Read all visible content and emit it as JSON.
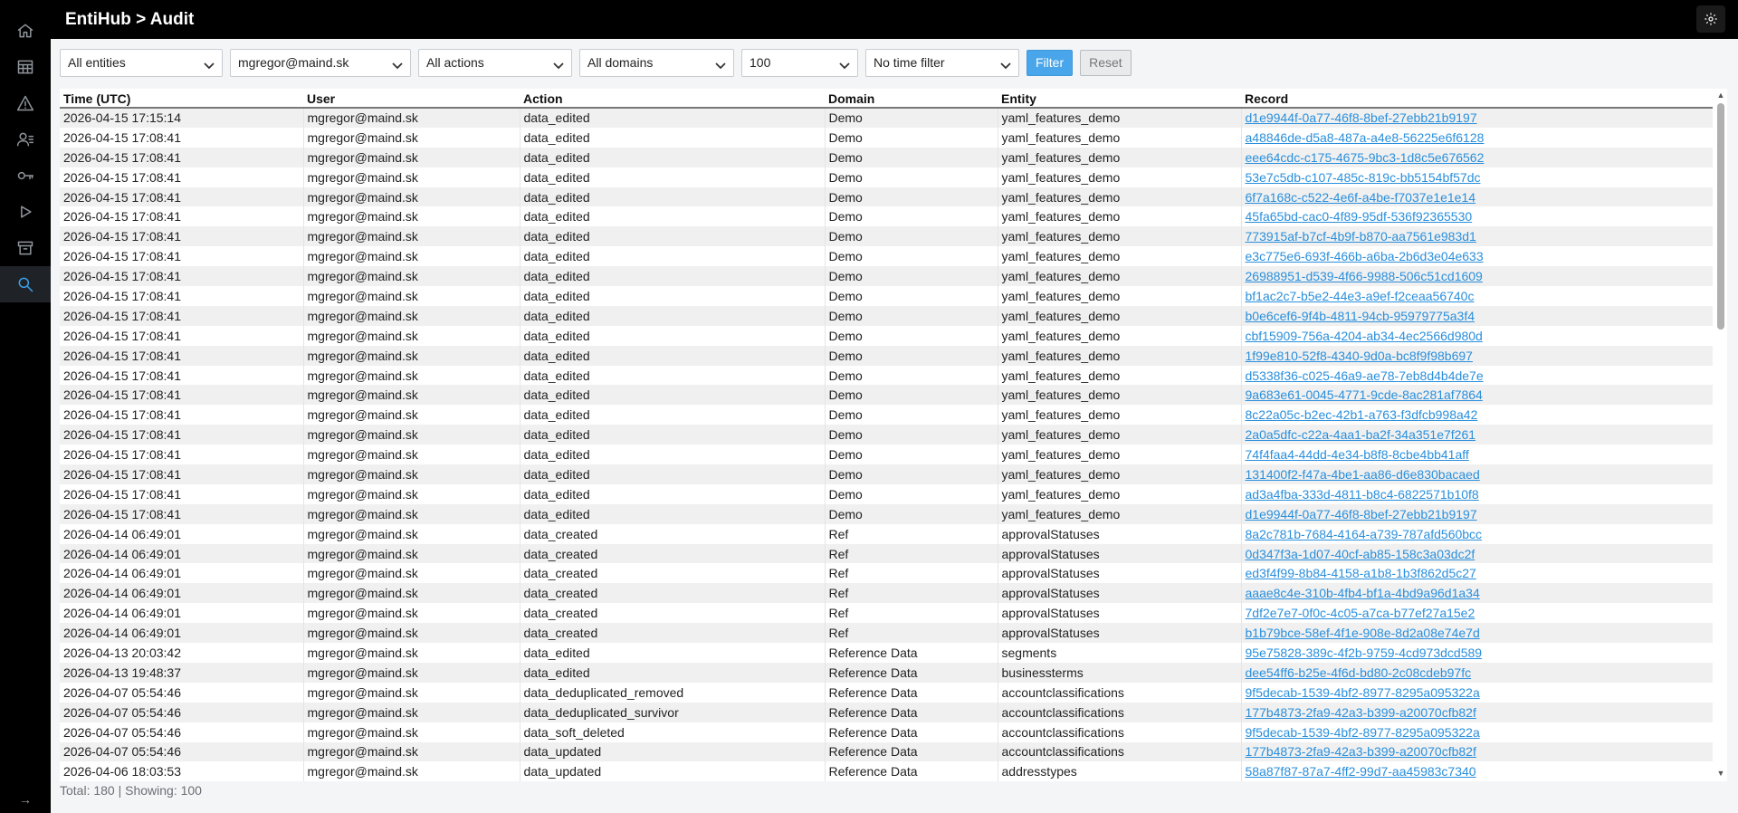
{
  "header": {
    "title": "EntiHub > Audit"
  },
  "sidebar": {
    "items": [
      {
        "icon": "home-icon"
      },
      {
        "icon": "table-icon"
      },
      {
        "icon": "warning-icon"
      },
      {
        "icon": "users-icon"
      },
      {
        "icon": "key-icon"
      },
      {
        "icon": "play-icon"
      },
      {
        "icon": "archive-icon"
      },
      {
        "icon": "search-icon",
        "active": true
      }
    ],
    "expand": "→"
  },
  "filters": {
    "entities": "All entities",
    "user": "mgregor@maind.sk",
    "actions": "All actions",
    "domains": "All domains",
    "limit": "100",
    "time": "No time filter",
    "filter_label": "Filter",
    "reset_label": "Reset"
  },
  "table": {
    "columns": [
      "Time (UTC)",
      "User",
      "Action",
      "Domain",
      "Entity",
      "Record"
    ],
    "rows": [
      [
        "2026-04-15 17:15:14",
        "mgregor@maind.sk",
        "data_edited",
        "Demo",
        "yaml_features_demo",
        "d1e9944f-0a77-46f8-8bef-27ebb21b9197"
      ],
      [
        "2026-04-15 17:08:41",
        "mgregor@maind.sk",
        "data_edited",
        "Demo",
        "yaml_features_demo",
        "a48846de-d5a8-487a-a4e8-56225e6f6128"
      ],
      [
        "2026-04-15 17:08:41",
        "mgregor@maind.sk",
        "data_edited",
        "Demo",
        "yaml_features_demo",
        "eee64cdc-c175-4675-9bc3-1d8c5e676562"
      ],
      [
        "2026-04-15 17:08:41",
        "mgregor@maind.sk",
        "data_edited",
        "Demo",
        "yaml_features_demo",
        "53e7c5db-c107-485c-819c-bb5154bf57dc"
      ],
      [
        "2026-04-15 17:08:41",
        "mgregor@maind.sk",
        "data_edited",
        "Demo",
        "yaml_features_demo",
        "6f7a168c-c522-4e6f-a4be-f7037e1e1e14"
      ],
      [
        "2026-04-15 17:08:41",
        "mgregor@maind.sk",
        "data_edited",
        "Demo",
        "yaml_features_demo",
        "45fa65bd-cac0-4f89-95df-536f92365530"
      ],
      [
        "2026-04-15 17:08:41",
        "mgregor@maind.sk",
        "data_edited",
        "Demo",
        "yaml_features_demo",
        "773915af-b7cf-4b9f-b870-aa7561e983d1"
      ],
      [
        "2026-04-15 17:08:41",
        "mgregor@maind.sk",
        "data_edited",
        "Demo",
        "yaml_features_demo",
        "e3c775e6-693f-466b-a6ba-2b6d3e04e633"
      ],
      [
        "2026-04-15 17:08:41",
        "mgregor@maind.sk",
        "data_edited",
        "Demo",
        "yaml_features_demo",
        "26988951-d539-4f66-9988-506c51cd1609"
      ],
      [
        "2026-04-15 17:08:41",
        "mgregor@maind.sk",
        "data_edited",
        "Demo",
        "yaml_features_demo",
        "bf1ac2c7-b5e2-44e3-a9ef-f2ceaa56740c"
      ],
      [
        "2026-04-15 17:08:41",
        "mgregor@maind.sk",
        "data_edited",
        "Demo",
        "yaml_features_demo",
        "b0e6cef6-9f4b-4811-94cb-95979775a3f4"
      ],
      [
        "2026-04-15 17:08:41",
        "mgregor@maind.sk",
        "data_edited",
        "Demo",
        "yaml_features_demo",
        "cbf15909-756a-4204-ab34-4ec2566d980d"
      ],
      [
        "2026-04-15 17:08:41",
        "mgregor@maind.sk",
        "data_edited",
        "Demo",
        "yaml_features_demo",
        "1f99e810-52f8-4340-9d0a-bc8f9f98b697"
      ],
      [
        "2026-04-15 17:08:41",
        "mgregor@maind.sk",
        "data_edited",
        "Demo",
        "yaml_features_demo",
        "d5338f36-c025-46a9-ae78-7eb8d4b4de7e"
      ],
      [
        "2026-04-15 17:08:41",
        "mgregor@maind.sk",
        "data_edited",
        "Demo",
        "yaml_features_demo",
        "9a683e61-0045-4771-9cde-8ac281af7864"
      ],
      [
        "2026-04-15 17:08:41",
        "mgregor@maind.sk",
        "data_edited",
        "Demo",
        "yaml_features_demo",
        "8c22a05c-b2ec-42b1-a763-f3dfcb998a42"
      ],
      [
        "2026-04-15 17:08:41",
        "mgregor@maind.sk",
        "data_edited",
        "Demo",
        "yaml_features_demo",
        "2a0a5dfc-c22a-4aa1-ba2f-34a351e7f261"
      ],
      [
        "2026-04-15 17:08:41",
        "mgregor@maind.sk",
        "data_edited",
        "Demo",
        "yaml_features_demo",
        "74f4faa4-44dd-4e34-b8f8-8cbe4bb41aff"
      ],
      [
        "2026-04-15 17:08:41",
        "mgregor@maind.sk",
        "data_edited",
        "Demo",
        "yaml_features_demo",
        "131400f2-f47a-4be1-aa86-d6e830bacaed"
      ],
      [
        "2026-04-15 17:08:41",
        "mgregor@maind.sk",
        "data_edited",
        "Demo",
        "yaml_features_demo",
        "ad3a4fba-333d-4811-b8c4-6822571b10f8"
      ],
      [
        "2026-04-15 17:08:41",
        "mgregor@maind.sk",
        "data_edited",
        "Demo",
        "yaml_features_demo",
        "d1e9944f-0a77-46f8-8bef-27ebb21b9197"
      ],
      [
        "2026-04-14 06:49:01",
        "mgregor@maind.sk",
        "data_created",
        "Ref",
        "approvalStatuses",
        "8a2c781b-7684-4164-a739-787afd560bcc"
      ],
      [
        "2026-04-14 06:49:01",
        "mgregor@maind.sk",
        "data_created",
        "Ref",
        "approvalStatuses",
        "0d347f3a-1d07-40cf-ab85-158c3a03dc2f"
      ],
      [
        "2026-04-14 06:49:01",
        "mgregor@maind.sk",
        "data_created",
        "Ref",
        "approvalStatuses",
        "ed3f4f99-8b84-4158-a1b8-1b3f862d5c27"
      ],
      [
        "2026-04-14 06:49:01",
        "mgregor@maind.sk",
        "data_created",
        "Ref",
        "approvalStatuses",
        "aaae8c4e-310b-4fb4-bf1a-4bd9a96d1a34"
      ],
      [
        "2026-04-14 06:49:01",
        "mgregor@maind.sk",
        "data_created",
        "Ref",
        "approvalStatuses",
        "7df2e7e7-0f0c-4c05-a7ca-b77ef27a15e2"
      ],
      [
        "2026-04-14 06:49:01",
        "mgregor@maind.sk",
        "data_created",
        "Ref",
        "approvalStatuses",
        "b1b79bce-58ef-4f1e-908e-8d2a08e74e7d"
      ],
      [
        "2026-04-13 20:03:42",
        "mgregor@maind.sk",
        "data_edited",
        "Reference Data",
        "segments",
        "95e75828-389c-4f2b-9759-4cd973dcd589"
      ],
      [
        "2026-04-13 19:48:37",
        "mgregor@maind.sk",
        "data_edited",
        "Reference Data",
        "businessterms",
        "dee54ff6-b25e-4f6d-bd80-2c08cdeb97fc"
      ],
      [
        "2026-04-07 05:54:46",
        "mgregor@maind.sk",
        "data_deduplicated_removed",
        "Reference Data",
        "accountclassifications",
        "9f5decab-1539-4bf2-8977-8295a095322a"
      ],
      [
        "2026-04-07 05:54:46",
        "mgregor@maind.sk",
        "data_deduplicated_survivor",
        "Reference Data",
        "accountclassifications",
        "177b4873-2fa9-42a3-b399-a20070cfb82f"
      ],
      [
        "2026-04-07 05:54:46",
        "mgregor@maind.sk",
        "data_soft_deleted",
        "Reference Data",
        "accountclassifications",
        "9f5decab-1539-4bf2-8977-8295a095322a"
      ],
      [
        "2026-04-07 05:54:46",
        "mgregor@maind.sk",
        "data_updated",
        "Reference Data",
        "accountclassifications",
        "177b4873-2fa9-42a3-b399-a20070cfb82f"
      ],
      [
        "2026-04-06 18:03:53",
        "mgregor@maind.sk",
        "data_updated",
        "Reference Data",
        "addresstypes",
        "58a87f87-87a7-4ff2-99d7-aa45983c7340"
      ]
    ]
  },
  "footer": {
    "summary": "Total: 180 | Showing: 100"
  }
}
